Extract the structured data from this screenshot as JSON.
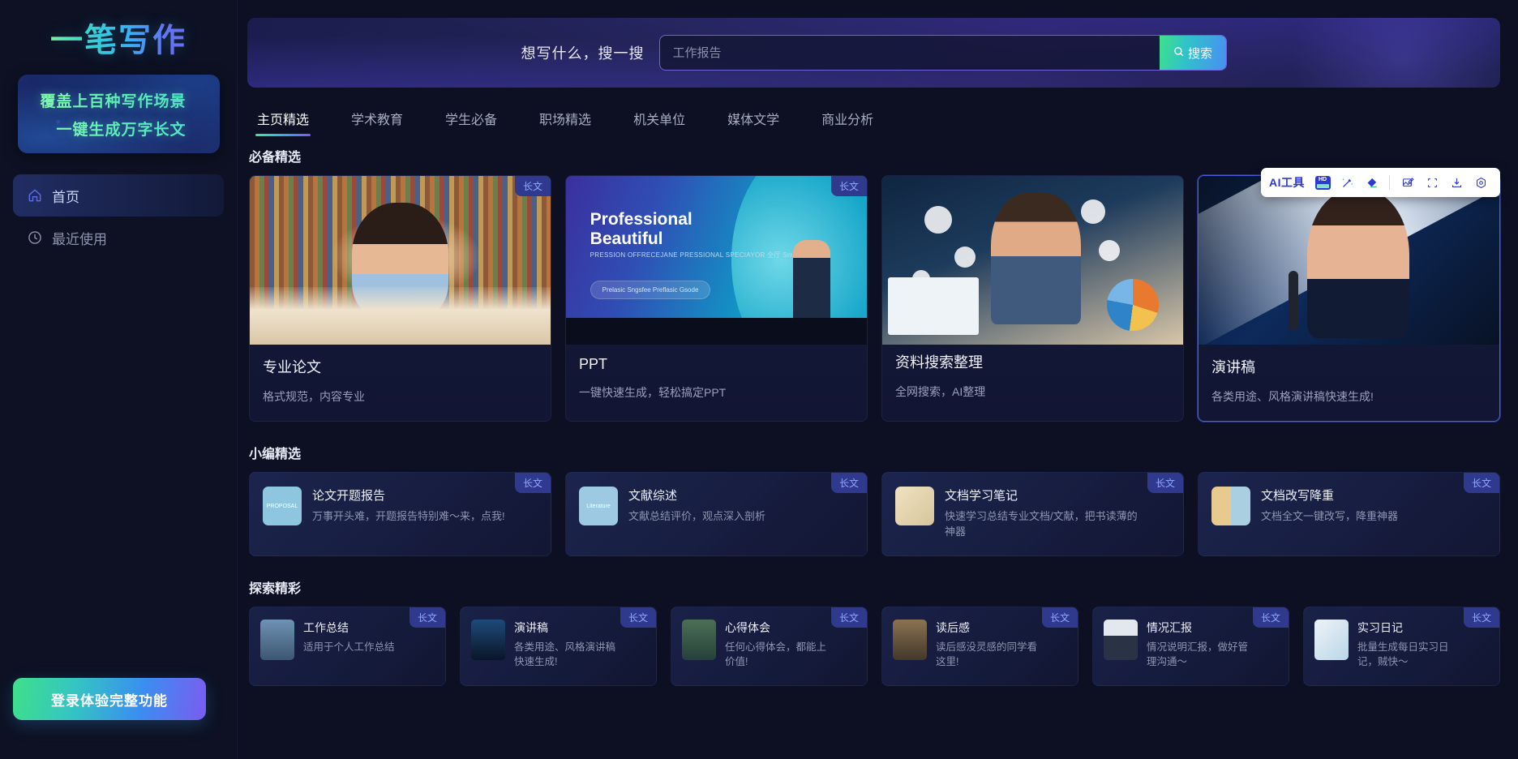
{
  "sidebar": {
    "logo": "一笔写作",
    "promo_line1": "覆盖上百种写作场景",
    "promo_line2": "一键生成万字长文",
    "nav": [
      {
        "label": "首页",
        "icon": "home-icon",
        "active": true
      },
      {
        "label": "最近使用",
        "icon": "clock-icon",
        "active": false
      }
    ],
    "login_button": "登录体验完整功能"
  },
  "hero": {
    "prompt_label": "想写什么，搜一搜",
    "search_placeholder": "工作报告",
    "search_value": "",
    "search_button": "搜索",
    "search_icon": "magnifier-icon"
  },
  "tabs": [
    {
      "label": "主页精选",
      "active": true
    },
    {
      "label": "学术教育",
      "active": false
    },
    {
      "label": "学生必备",
      "active": false
    },
    {
      "label": "职场精选",
      "active": false
    },
    {
      "label": "机关单位",
      "active": false
    },
    {
      "label": "媒体文学",
      "active": false
    },
    {
      "label": "商业分析",
      "active": false
    }
  ],
  "ai_toolbar": {
    "label": "AI工具",
    "buttons": [
      {
        "name": "hd-enhance-icon",
        "title": "HD"
      },
      {
        "name": "magic-wand-icon",
        "title": "魔法棒"
      },
      {
        "name": "eraser-icon",
        "title": "橡皮擦"
      },
      {
        "name": "image-edit-icon",
        "title": "图片编辑"
      },
      {
        "name": "crop-icon",
        "title": "裁剪"
      },
      {
        "name": "download-icon",
        "title": "下载"
      },
      {
        "name": "settings-icon",
        "title": "设置"
      }
    ]
  },
  "sections": [
    {
      "title": "必备精选",
      "type": "featured",
      "cards": [
        {
          "title": "专业论文",
          "desc": "格式规范，内容专业",
          "badge": "长文",
          "art": "art-library",
          "selected": false
        },
        {
          "title": "PPT",
          "desc": "一键快速生成，轻松搞定PPT",
          "badge": "长文",
          "art": "art-ppt",
          "selected": false,
          "ppt_title": "Professional\nBeautiful",
          "ppt_sub": "PRESSION OFFRECEJANE PRESSIONAL SPECIAYOR 全厅 Sm门38/8",
          "ppt_pill": "Prelasic Sngsfee Preflasic Gsode"
        },
        {
          "title": "资料搜索整理",
          "desc": "全网搜索，AI整理",
          "badge": "",
          "art": "art-data",
          "selected": false
        },
        {
          "title": "演讲稿",
          "desc": "各类用途、风格演讲稿快速生成!",
          "badge": "长文",
          "art": "art-speech",
          "selected": true
        }
      ]
    },
    {
      "title": "小编精选",
      "type": "medium",
      "cards": [
        {
          "title": "论文开题报告",
          "desc": "万事开头难，开题报告特别难～来，点我!",
          "badge": "长文",
          "thumb_label": "PROPOSAL",
          "thumb_color": "#8fc6df"
        },
        {
          "title": "文献综述",
          "desc": "文献总结评价，观点深入剖析",
          "badge": "长文",
          "thumb_label": "Literature",
          "thumb_color": "#9dc9e2"
        },
        {
          "title": "文档学习笔记",
          "desc": "快速学习总结专业文档/文献，把书读薄的神器",
          "badge": "长文",
          "thumb_label": "",
          "thumb_color": "#e3d4ae"
        },
        {
          "title": "文档改写降重",
          "desc": "文档全文一键改写，降重神器",
          "badge": "长文",
          "thumb_label": "",
          "thumb_color": "#e0c38c"
        }
      ]
    },
    {
      "title": "探索精彩",
      "type": "small",
      "cards": [
        {
          "title": "工作总结",
          "desc": "适用于个人工作总结",
          "badge": "长文",
          "thumb_color": "#5b7fa6"
        },
        {
          "title": "演讲稿",
          "desc": "各类用途、风格演讲稿快速生成!",
          "badge": "长文",
          "thumb_color": "#16304f"
        },
        {
          "title": "心得体会",
          "desc": "任何心得体会，都能上价值!",
          "badge": "长文",
          "thumb_color": "#3f5b4a"
        },
        {
          "title": "读后感",
          "desc": "读后感没灵感的同学看这里!",
          "badge": "长文",
          "thumb_color": "#6b5a42"
        },
        {
          "title": "情况汇报",
          "desc": "情况说明汇报，做好管理沟通～",
          "badge": "长文",
          "thumb_color": "#c9cfd8"
        },
        {
          "title": "实习日记",
          "desc": "批量生成每日实习日记，贼快～",
          "badge": "长文",
          "thumb_color": "#bcd6e6"
        }
      ]
    }
  ],
  "colors": {
    "accent_green": "#3fe08a",
    "accent_blue": "#4a8ef2",
    "accent_purple": "#7b5cf0",
    "badge_bg": "#2f3a8f",
    "badge_text": "#93a6ff",
    "page_bg": "#0c1022"
  }
}
